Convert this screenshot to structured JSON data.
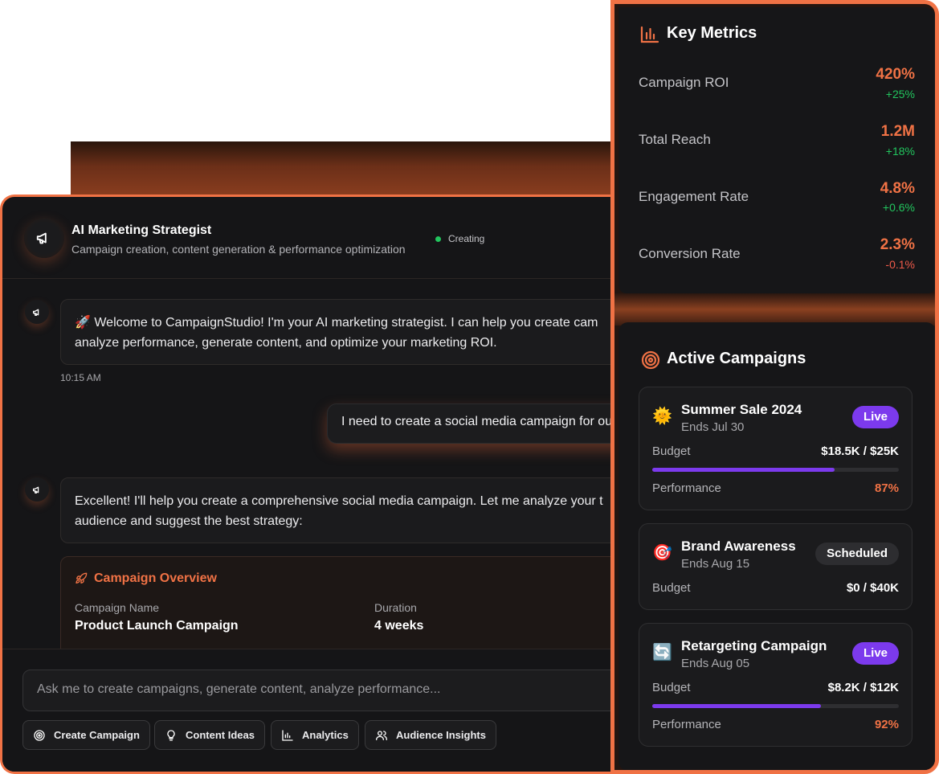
{
  "chat": {
    "header": {
      "title": "AI Marketing Strategist",
      "subtitle": "Campaign creation, content generation & performance optimization",
      "status": "Creating"
    },
    "messages": [
      {
        "role": "assistant",
        "text_line1": "🚀 Welcome to CampaignStudio! I'm your AI marketing strategist. I can help you create cam",
        "text_line2": "analyze performance, generate content, and optimize your marketing ROI.",
        "timestamp": "10:15 AM"
      },
      {
        "role": "user",
        "text": "I need to create a social media campaign for ou"
      },
      {
        "role": "assistant",
        "text_line1": "Excellent! I'll help you create a comprehensive social media campaign. Let me analyze your t",
        "text_line2": "audience and suggest the best strategy:"
      }
    ],
    "overview": {
      "title": "Campaign Overview",
      "name_label": "Campaign Name",
      "name_value": "Product Launch Campaign",
      "duration_label": "Duration",
      "duration_value": "4 weeks"
    },
    "input": {
      "placeholder": "Ask me to create campaigns, generate content, analyze performance..."
    },
    "quick_actions": [
      {
        "label": "Create Campaign",
        "icon": "target-icon"
      },
      {
        "label": "Content Ideas",
        "icon": "lightbulb-icon"
      },
      {
        "label": "Analytics",
        "icon": "bar-chart-icon"
      },
      {
        "label": "Audience Insights",
        "icon": "users-icon"
      }
    ]
  },
  "metrics": {
    "title": "Key Metrics",
    "items": [
      {
        "label": "Campaign ROI",
        "value": "420%",
        "delta": "+25%",
        "trend": "up"
      },
      {
        "label": "Total Reach",
        "value": "1.2M",
        "delta": "+18%",
        "trend": "up"
      },
      {
        "label": "Engagement Rate",
        "value": "4.8%",
        "delta": "+0.6%",
        "trend": "up"
      },
      {
        "label": "Conversion Rate",
        "value": "2.3%",
        "delta": "-0.1%",
        "trend": "down"
      }
    ]
  },
  "campaigns": {
    "title": "Active Campaigns",
    "budget_label": "Budget",
    "performance_label": "Performance",
    "items": [
      {
        "icon": "🌞",
        "name": "Summer Sale 2024",
        "ends": "Ends Jul 30",
        "status": "Live",
        "budget": "$18.5K / $25K",
        "budget_fraction": 0.74,
        "performance": "87%"
      },
      {
        "icon": "🎯",
        "name": "Brand Awareness",
        "ends": "Ends Aug 15",
        "status": "Scheduled",
        "budget": "$0 / $40K"
      },
      {
        "icon": "🔄",
        "name": "Retargeting Campaign",
        "ends": "Ends Aug 05",
        "status": "Live",
        "budget": "$8.2K / $12K",
        "budget_fraction": 0.683,
        "performance": "92%"
      }
    ]
  },
  "colors": {
    "accent": "#f07245",
    "live_badge": "#7c3aed",
    "positive": "#22c55e",
    "negative": "#ef5a4a"
  }
}
